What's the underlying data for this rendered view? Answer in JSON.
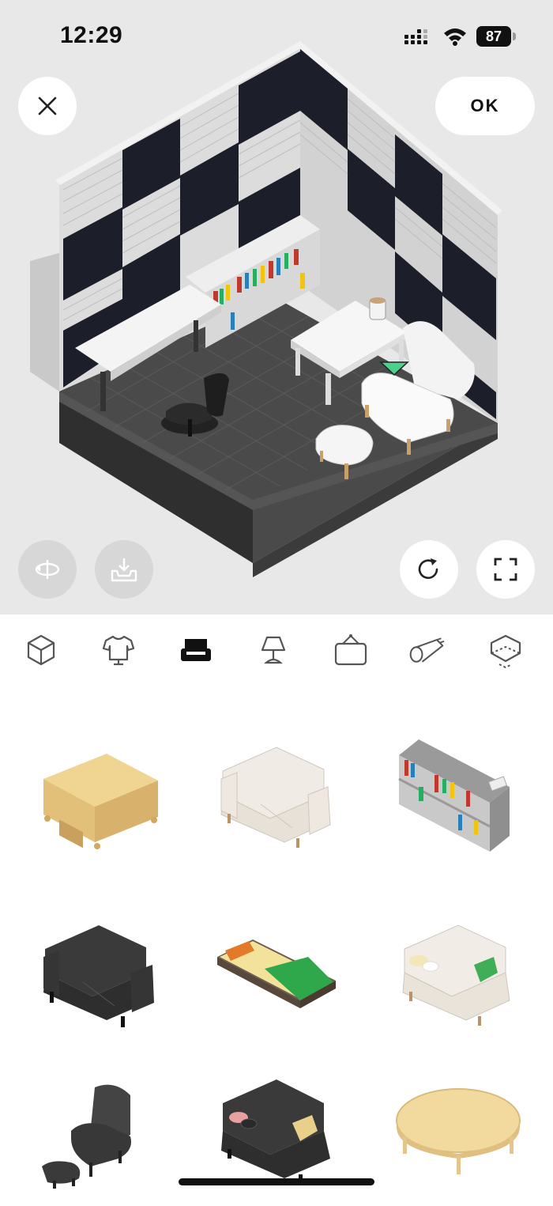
{
  "status_bar": {
    "time": "12:29",
    "battery": "87"
  },
  "toolbar": {
    "ok_label": "OK"
  },
  "icons": {
    "close": "close-icon",
    "rotate_view": "rotate-view-icon",
    "save": "download-tray-icon",
    "reset": "refresh-icon",
    "fullscreen": "fullscreen-icon"
  },
  "tabs": [
    {
      "icon": "room-cube-icon",
      "selected": false
    },
    {
      "icon": "shirt-icon",
      "selected": false
    },
    {
      "icon": "sofa-icon",
      "selected": true
    },
    {
      "icon": "lamp-icon",
      "selected": false
    },
    {
      "icon": "wall-frame-icon",
      "selected": false
    },
    {
      "icon": "rug-roll-icon",
      "selected": false
    },
    {
      "icon": "floor-tile-icon",
      "selected": false
    }
  ],
  "catalog": [
    {
      "name": "wooden-tv-stand"
    },
    {
      "name": "white-sofa"
    },
    {
      "name": "bookshelf"
    },
    {
      "name": "black-sofa"
    },
    {
      "name": "bed-green-blanket"
    },
    {
      "name": "cream-sofa-cushions"
    },
    {
      "name": "black-armchair-ottoman"
    },
    {
      "name": "black-sofa-cushions"
    },
    {
      "name": "oval-wooden-table"
    }
  ],
  "colors": {
    "background_top": "#e8e8e8",
    "selected_tab": "#111111",
    "tab_icon": "#555555"
  }
}
